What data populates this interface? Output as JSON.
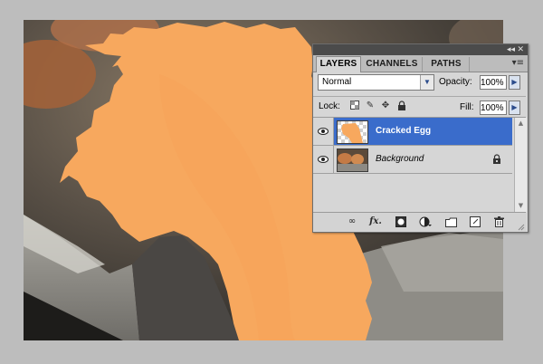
{
  "panel": {
    "tabs": [
      {
        "label": "LAYERS",
        "active": true
      },
      {
        "label": "CHANNELS",
        "active": false
      },
      {
        "label": "PATHS",
        "active": false
      }
    ],
    "blend_mode": "Normal",
    "opacity_label": "Opacity:",
    "opacity_value": "100%",
    "lock_label": "Lock:",
    "fill_label": "Fill:",
    "fill_value": "100%",
    "layers": [
      {
        "name": "Cracked Egg",
        "visible": true,
        "selected": true,
        "italic": false,
        "locked": false
      },
      {
        "name": "Background",
        "visible": true,
        "selected": false,
        "italic": true,
        "locked": true
      }
    ],
    "footer_icons": [
      "link-icon",
      "fx-icon",
      "mask-icon",
      "adjustment-icon",
      "group-folder-icon",
      "new-layer-icon",
      "trash-icon"
    ],
    "footer_fx": "fx."
  },
  "colors": {
    "egg_shell": "#f7a85e",
    "selection_blue": "#3a6ccb",
    "canvas_bg": "#3b3a36"
  }
}
